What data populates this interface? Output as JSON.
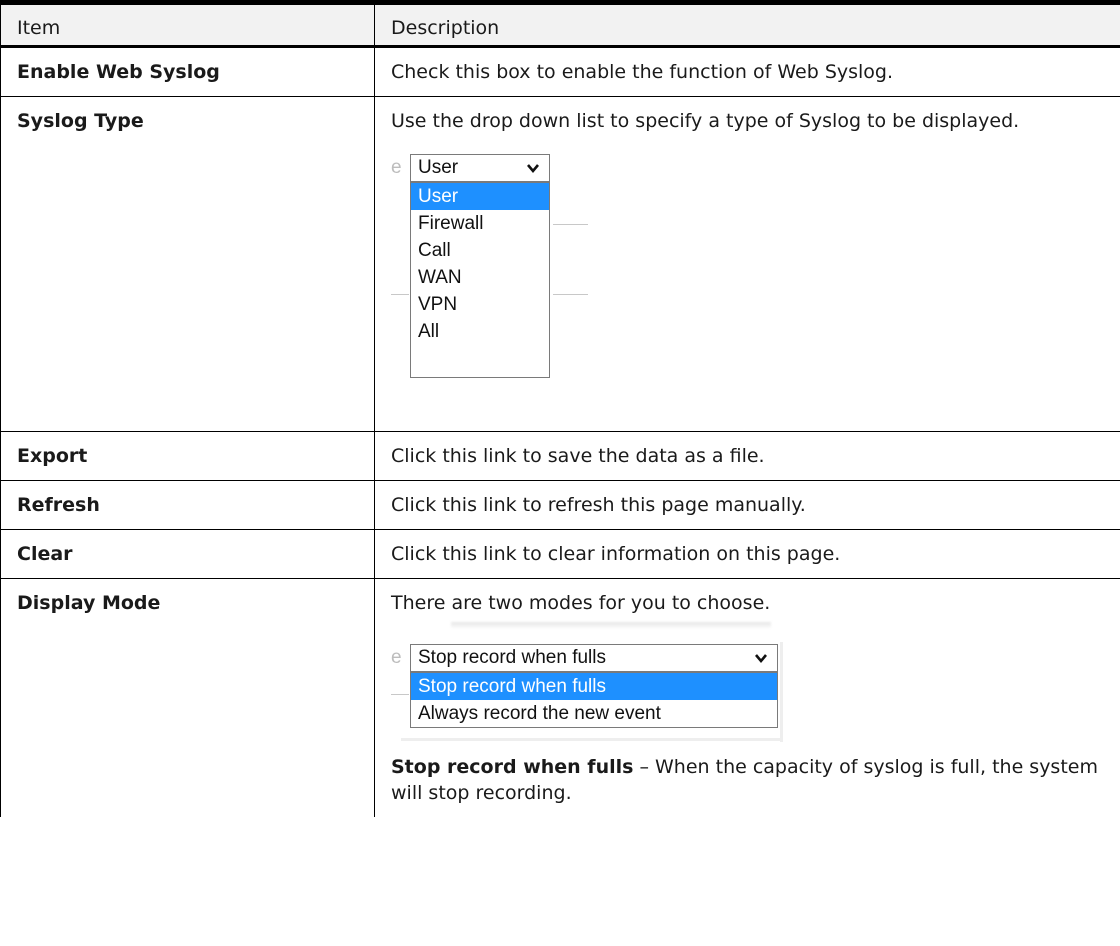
{
  "table": {
    "headers": {
      "item": "Item",
      "description": "Description"
    },
    "rows": [
      {
        "item": "Enable Web Syslog",
        "description": "Check this box to enable the function of Web Syslog."
      },
      {
        "item": "Syslog Type",
        "description": "Use the drop down list to specify a type of Syslog to be displayed."
      },
      {
        "item": "Export",
        "description": "Click this link to save the data as a file."
      },
      {
        "item": "Refresh",
        "description": "Click this link to refresh this page manually."
      },
      {
        "item": "Clear",
        "description": "Click this link to clear information on this page."
      },
      {
        "item": "Display Mode",
        "description": "There are two modes for you to choose."
      }
    ]
  },
  "syslog_dropdown": {
    "selected": "User",
    "options": [
      "User",
      "Firewall",
      "Call",
      "WAN",
      "VPN",
      "All"
    ],
    "highlighted": "User"
  },
  "mode_dropdown": {
    "selected": "Stop record when fulls",
    "options": [
      "Stop record when fulls",
      "Always record the new event"
    ],
    "highlighted": "Stop record when fulls"
  },
  "display_mode_note": {
    "term": "Stop record when fulls",
    "text": " – When the capacity of syslog is full, the system will stop recording."
  },
  "colors": {
    "highlight": "#1e90ff",
    "header_bg": "#f2f2f2",
    "border": "#000000"
  }
}
